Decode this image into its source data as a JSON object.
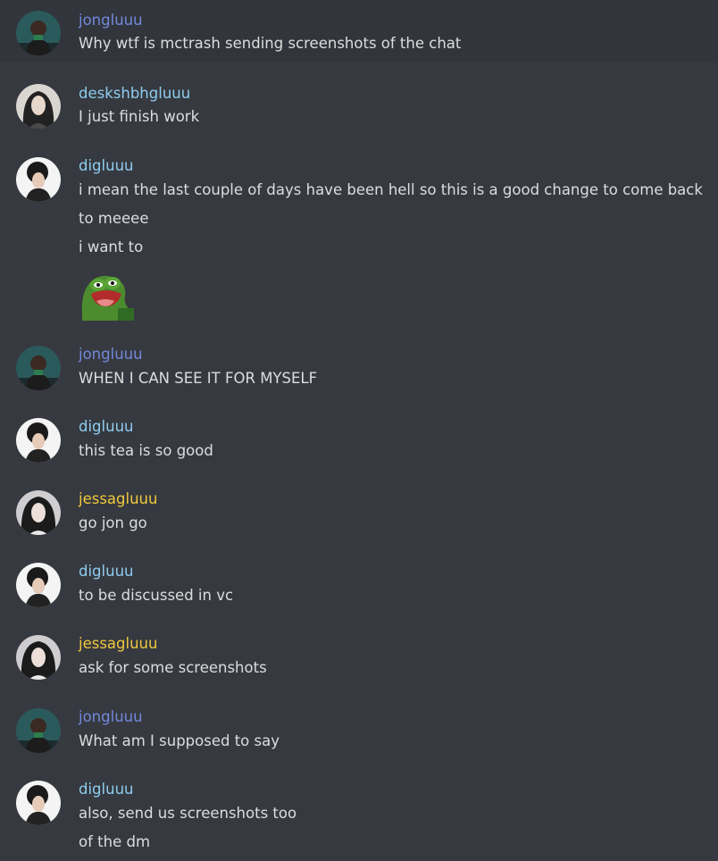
{
  "colors": {
    "background": "#36393f",
    "hover_row": "#32353b",
    "message_text": "#dcddde"
  },
  "users": {
    "jongluuu": {
      "name": "jongluuu",
      "color": "#7289da",
      "avatar_icon": "avatar-man-dark-jacket"
    },
    "deskshbhgluuu": {
      "name": "deskshbhgluuu",
      "color": "#8ecdf0",
      "avatar_icon": "avatar-long-hair-portrait"
    },
    "digluuu": {
      "name": "digluuu",
      "color": "#8ecdf0",
      "avatar_icon": "avatar-curly-hair-portrait"
    },
    "jessagluuu": {
      "name": "jessagluuu",
      "color": "#f0c93e",
      "avatar_icon": "avatar-long-hair-portrait"
    }
  },
  "messages": [
    {
      "author": "jongluuu",
      "author_color": "#7289da",
      "lines": [
        "Why wtf is mctrash sending screenshots of the chat"
      ]
    },
    {
      "author": "deskshbhgluuu",
      "author_color": "#8ecdf0",
      "lines": [
        "I just finish work"
      ]
    },
    {
      "author": "digluuu",
      "author_color": "#8ecdf0",
      "lines": [
        "i mean the last couple of days have been hell so this is a good change to come back to meeee",
        "i want to"
      ],
      "emoji": "pepe-laughing-emoji"
    },
    {
      "author": "jongluuu",
      "author_color": "#7289da",
      "lines": [
        "WHEN I CAN SEE IT FOR MYSELF"
      ]
    },
    {
      "author": "digluuu",
      "author_color": "#8ecdf0",
      "lines": [
        "this tea is so good"
      ]
    },
    {
      "author": "jessagluuu",
      "author_color": "#f0c93e",
      "lines": [
        "go jon go"
      ]
    },
    {
      "author": "digluuu",
      "author_color": "#8ecdf0",
      "lines": [
        "to be discussed in vc"
      ]
    },
    {
      "author": "jessagluuu",
      "author_color": "#f0c93e",
      "lines": [
        "ask for some screenshots"
      ]
    },
    {
      "author": "jongluuu",
      "author_color": "#7289da",
      "lines": [
        "What am I supposed to say"
      ]
    },
    {
      "author": "digluuu",
      "author_color": "#8ecdf0",
      "lines": [
        "also, send us screenshots too",
        "of the dm"
      ]
    }
  ]
}
